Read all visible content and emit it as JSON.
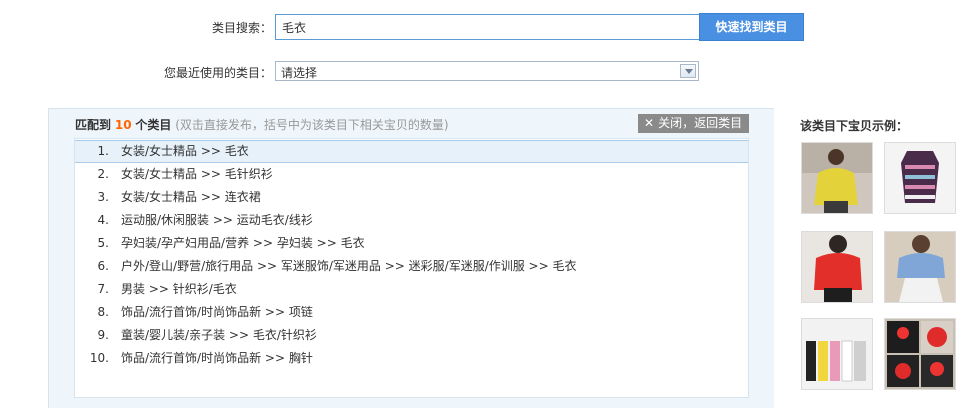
{
  "search": {
    "label": "类目搜索：",
    "value": "毛衣",
    "button": "快速找到类目"
  },
  "recent": {
    "label": "您最近使用的类目：",
    "selected": "请选择"
  },
  "results": {
    "prefix": "匹配到",
    "count": "10",
    "suffix": "个类目",
    "hint": "(双击直接发布，括号中为该类目下相关宝贝的数量)",
    "close_label": "关闭，返回类目",
    "items": [
      {
        "num": "1.",
        "path": "女装/女士精品 >> 毛衣"
      },
      {
        "num": "2.",
        "path": "女装/女士精品 >> 毛针织衫"
      },
      {
        "num": "3.",
        "path": "女装/女士精品 >> 连衣裙"
      },
      {
        "num": "4.",
        "path": "运动服/休闲服装 >> 运动毛衣/线衫"
      },
      {
        "num": "5.",
        "path": "孕妇装/孕产妇用品/营养 >> 孕妇装 >> 毛衣"
      },
      {
        "num": "6.",
        "path": "户外/登山/野营/旅行用品 >> 军迷服饰/军迷用品 >> 迷彩服/军迷服/作训服 >> 毛衣"
      },
      {
        "num": "7.",
        "path": "男装 >> 针织衫/毛衣"
      },
      {
        "num": "8.",
        "path": "饰品/流行首饰/时尚饰品新 >> 项链"
      },
      {
        "num": "9.",
        "path": "童装/婴儿装/亲子装 >> 毛衣/针织衫"
      },
      {
        "num": "10.",
        "path": "饰品/流行首饰/时尚饰品新 >> 胸针"
      }
    ]
  },
  "samples": {
    "title": "该类目下宝贝示例：",
    "thumbs": [
      "yellow-sweater-photo",
      "striped-knit-top-photo",
      "red-sweater-photo",
      "blue-sweater-photo",
      "colorful-knit-display-photo",
      "red-black-cartoon-sweater-photo"
    ]
  }
}
